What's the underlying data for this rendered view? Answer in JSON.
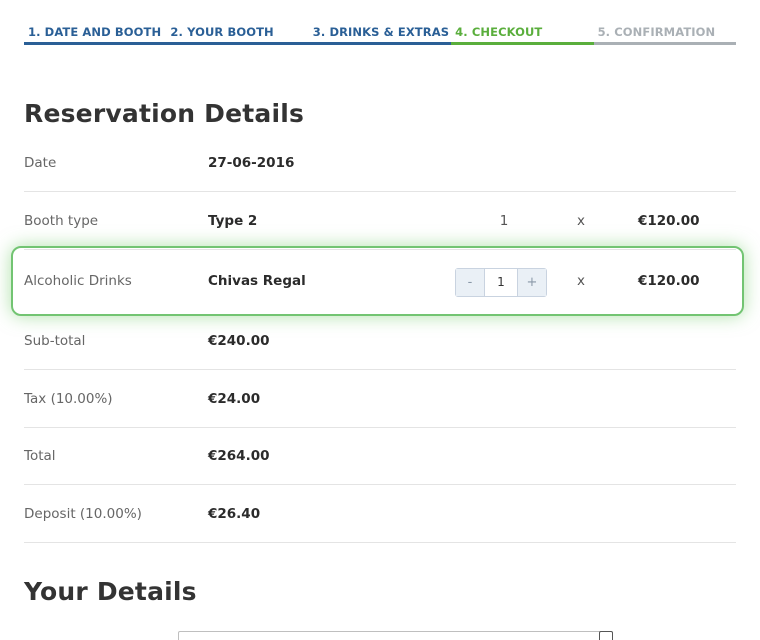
{
  "steps": [
    {
      "label": "1. DATE AND BOOTH",
      "state": "done"
    },
    {
      "label": "2. YOUR BOOTH",
      "state": "done"
    },
    {
      "label": "3. DRINKS & EXTRAS",
      "state": "done"
    },
    {
      "label": "4. CHECKOUT",
      "state": "active"
    },
    {
      "label": "5. CONFIRMATION",
      "state": "pending"
    }
  ],
  "colors": {
    "step_done": "#2a5f96",
    "step_active": "#5aae3c",
    "step_pending": "#aab0b5",
    "highlight": "#72c472"
  },
  "reservation": {
    "title": "Reservation Details",
    "date": {
      "label": "Date",
      "value": "27-06-2016"
    },
    "booth": {
      "label": "Booth type",
      "value": "Type 2",
      "qty": "1",
      "times": "x",
      "price": "€120.00"
    },
    "drinks": {
      "label": "Alcoholic Drinks",
      "value": "Chivas Regal",
      "stepper": {
        "minus": "-",
        "value": "1",
        "plus": "+"
      },
      "times": "x",
      "price": "€120.00"
    },
    "subtotal": {
      "label": "Sub-total",
      "value": "€240.00"
    },
    "tax": {
      "label": "Tax (10.00%)",
      "value": "€24.00"
    },
    "total": {
      "label": "Total",
      "value": "€264.00"
    },
    "deposit": {
      "label": "Deposit (10.00%)",
      "value": "€26.40"
    }
  },
  "details": {
    "title": "Your Details"
  }
}
